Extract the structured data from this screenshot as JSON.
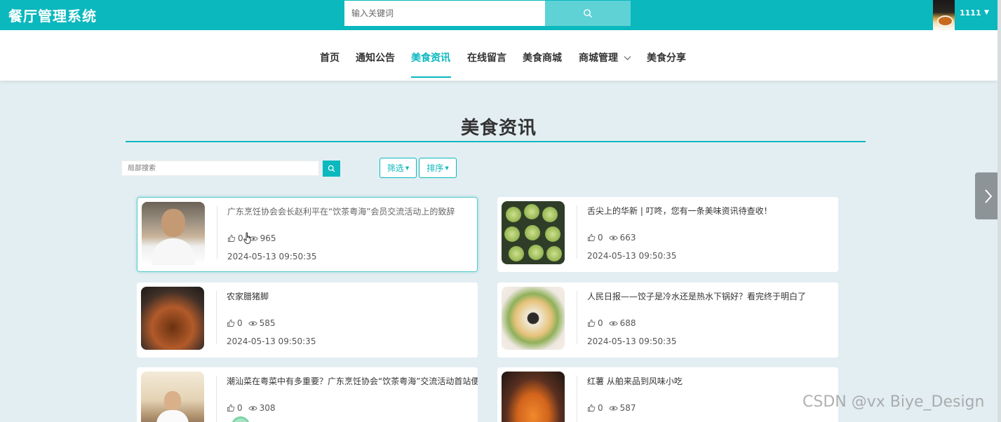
{
  "header": {
    "app_title": "餐厅管理系统",
    "search_placeholder": "输入关键词",
    "username": "1111"
  },
  "nav": {
    "items": [
      {
        "label": "首页"
      },
      {
        "label": "通知公告"
      },
      {
        "label": "美食资讯",
        "active": true
      },
      {
        "label": "在线留言"
      },
      {
        "label": "美食商城"
      },
      {
        "label": "商城管理",
        "has_dropdown": true
      },
      {
        "label": "美食分享"
      }
    ]
  },
  "section": {
    "title": "美食资讯"
  },
  "filters": {
    "local_search_placeholder": "局部搜索",
    "filter_label": "筛选",
    "sort_label": "排序"
  },
  "cards": [
    {
      "title": "广东烹饪协会会长赵利平在“饮茶粤海”会员交流活动上的致辞",
      "likes": "0",
      "views": "965",
      "date": "2024-05-13 09:50:35",
      "thumb": "chef"
    },
    {
      "title": "舌尖上的华新 | 叮咚，您有一条美味资讯待查收！",
      "likes": "0",
      "views": "663",
      "date": "2024-05-13 09:50:35",
      "thumb": "cakes"
    },
    {
      "title": "农家腊猪脚",
      "likes": "0",
      "views": "585",
      "date": "2024-05-13 09:50:35",
      "thumb": "pork"
    },
    {
      "title": "人民日报——饺子是冷水还是热水下锅好？看完终于明白了",
      "likes": "0",
      "views": "688",
      "date": "2024-05-13 09:50:35",
      "thumb": "dumpling"
    },
    {
      "title": "潮汕菜在粤菜中有多重要？广东烹饪协会“饮茶粤海”交流活动首站便",
      "likes": "0",
      "views": "308",
      "date": "",
      "thumb": "cook"
    },
    {
      "title": "红薯 从舶来品到风味小吃",
      "likes": "0",
      "views": "587",
      "date": "",
      "thumb": "yam"
    }
  ],
  "watermark": "CSDN @vx Biye_Design",
  "colors": {
    "accent": "#0ab8be",
    "search_button": "#5fd2d6",
    "page_background": "#e3eef2"
  }
}
